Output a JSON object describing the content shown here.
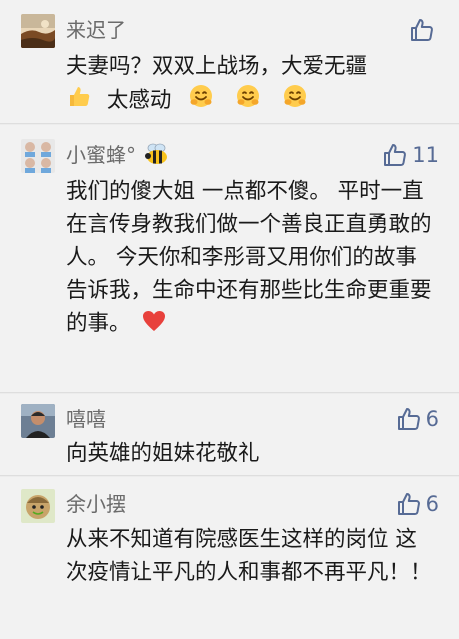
{
  "comments": [
    {
      "user": "来迟了",
      "likes": "",
      "text": "夫妻吗？双双上战场，大爱无疆",
      "text2": "太感动",
      "avatar_icon": "landscape-avatar-icon"
    },
    {
      "user": "小蜜蜂°",
      "likes": "11",
      "text": "我们的傻大姐 一点都不傻。 平时一直在言传身教我们做一个善良正直勇敢的人。 今天你和李彤哥又用你们的故事告诉我，生命中还有那些比生命更重要的事。",
      "avatar_icon": "group-avatar-icon"
    },
    {
      "user": "嘻嘻",
      "likes": "6",
      "text": "向英雄的姐妹花敬礼",
      "avatar_icon": "person-avatar-icon"
    },
    {
      "user": "余小摆",
      "likes": "6",
      "text": "从来不知道有院感医生这样的岗位 这次疫情让平凡的人和事都不再平凡！！",
      "avatar_icon": "cartoon-avatar-icon"
    }
  ],
  "colors": {
    "like_blue": "#576b95",
    "card_bg": "#f2f2f2",
    "name_gray": "#6b6b6b"
  }
}
